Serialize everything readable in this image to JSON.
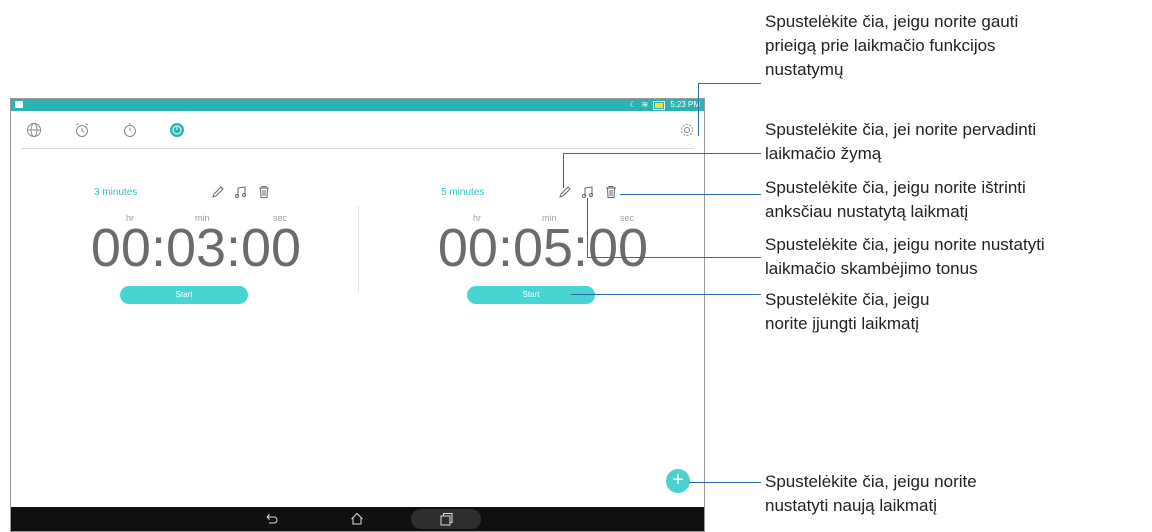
{
  "status_bar": {
    "time": "5:23 PM"
  },
  "tabs": [
    {
      "name": "world-clock",
      "icon": "globe-icon"
    },
    {
      "name": "alarm",
      "icon": "alarm-clock-icon"
    },
    {
      "name": "stopwatch",
      "icon": "stopwatch-icon"
    },
    {
      "name": "timer",
      "icon": "timer-icon"
    }
  ],
  "timers": [
    {
      "label": "3 minutes",
      "hr_label": "hr",
      "min_label": "min",
      "sec_label": "sec",
      "time": "00:03:00",
      "start_label": "Start"
    },
    {
      "label": "5 minutes",
      "hr_label": "hr",
      "min_label": "min",
      "sec_label": "sec",
      "time": "00:05:00",
      "start_label": "Start"
    }
  ],
  "fab": {
    "symbol": "+"
  },
  "annotations": {
    "settings": [
      "Spustelėkite čia, jeigu norite gauti",
      "prieigą prie laikmačio funkcijos",
      "nustatymų"
    ],
    "rename": [
      "Spustelėkite čia, jei norite pervadinti",
      "laikmačio žymą"
    ],
    "delete": [
      "Spustelėkite čia, jeigu norite ištrinti",
      "anksčiau nustatytą laikmatį"
    ],
    "ringtone": [
      "Spustelėkite čia, jeigu norite nustatyti",
      "laikmačio skambėjimo tonus"
    ],
    "start": [
      "Spustelėkite čia, jeigu",
      "norite įjungti laikmatį"
    ],
    "new_timer": [
      "Spustelėkite čia, jeigu norite",
      "nustatyti naują laikmatį"
    ]
  },
  "colors": {
    "accent": "#2ab3b1",
    "button": "#49d4d4",
    "callout_line": "#2a6aa8"
  }
}
